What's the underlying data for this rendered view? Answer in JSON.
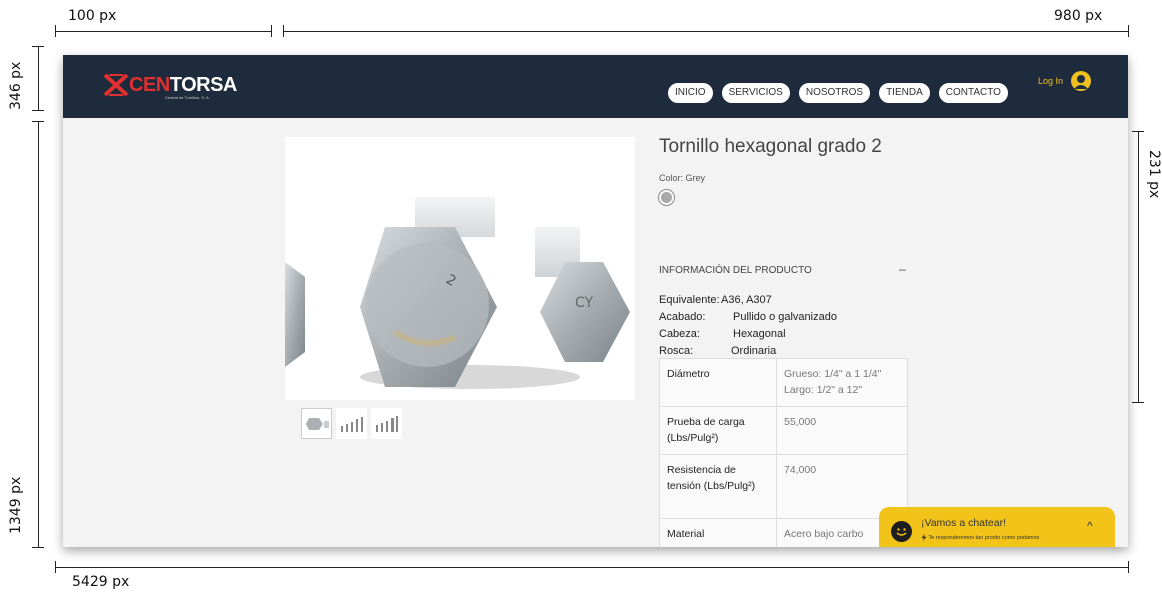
{
  "annotations": {
    "top_left": "100 px",
    "top_right": "980 px",
    "left_top": "346 px",
    "right_mid": "231 px",
    "left_bottom": "1349 px",
    "bottom": "5429 px"
  },
  "header": {
    "logo_brand_red": "CEN",
    "logo_brand_white": "TORSA",
    "logo_subtitle": "Central de Tornillos, S. A.",
    "nav": [
      "INICIO",
      "SERVICIOS",
      "NOSOTROS",
      "TIENDA",
      "CONTACTO"
    ],
    "login_label": "Log In"
  },
  "product": {
    "title": "Tornillo hexagonal grado 2",
    "color_label": "Color: Grey",
    "info_heading": "INFORMACIÓN DEL PRODUCTO",
    "info_toggle": "–",
    "specs": [
      {
        "label": "Equivalente:",
        "value": "A36, A307"
      },
      {
        "label": "Acabado:",
        "value": "Pullido o galvanizado"
      },
      {
        "label": "Cabeza:",
        "value": "Hexagonal"
      },
      {
        "label": "Rosca:",
        "value": "Ordinaria"
      }
    ],
    "table": [
      {
        "key": "Diámetro",
        "value": "Grueso: 1/4\" a 1 1/4\" Largo: 1/2\" a 12\""
      },
      {
        "key": "Prueba de carga (Lbs/Pulg²)",
        "value": "55,000"
      },
      {
        "key": "Resistencia de tensión (Lbs/Pulg²)",
        "value": "74,000"
      },
      {
        "key": "Material",
        "value": "Acero bajo carbo"
      }
    ]
  },
  "chat": {
    "title": "¡Vamos a chatear!",
    "subtitle": "Te responderemos tan pronto como podamos",
    "chevron": "^"
  },
  "colors": {
    "header_bg": "#1e2b3c",
    "accent_red": "#e03030",
    "accent_yellow": "#f2c419"
  }
}
